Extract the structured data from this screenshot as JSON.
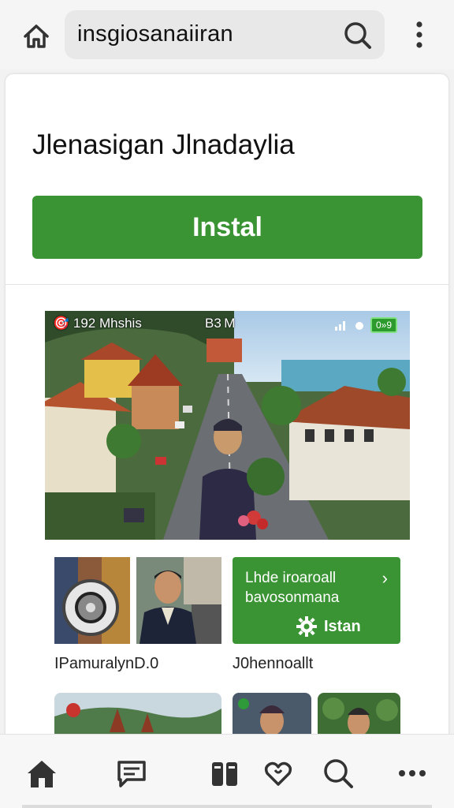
{
  "browser": {
    "url_text": "insgiosanaiiran",
    "icons": [
      "home-icon",
      "search-icon",
      "more-vert-icon"
    ]
  },
  "app": {
    "title": "Jlenasigan Jlnadaylia",
    "install_label": "Instal"
  },
  "screenshot": {
    "status_left": "🎯 192 Mhshis",
    "status_mid": "B3 M",
    "battery": "0»9"
  },
  "promo": {
    "line1": "Lhde iroaroall",
    "line2": "bavosonmana",
    "install_label": "Istan",
    "arrow": "›"
  },
  "captions": {
    "left": "IPamuralynD.0",
    "right": "J0hennoallt"
  },
  "bottom_nav": {
    "items": [
      "home-icon",
      "messages-icon",
      "library-icon",
      "favorites-icon",
      "search-icon",
      "more-icon"
    ]
  },
  "colors": {
    "accent": "#3a9433",
    "background": "#f2f2f2",
    "card": "#ffffff"
  }
}
